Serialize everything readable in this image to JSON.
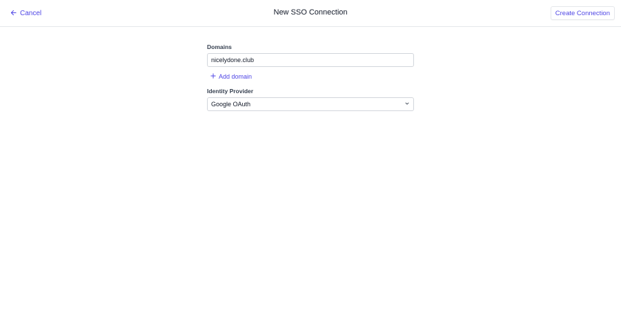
{
  "header": {
    "cancel_label": "Cancel",
    "title": "New SSO Connection",
    "create_label": "Create Connection"
  },
  "form": {
    "domains_label": "Domains",
    "domain_value": "nicelydone.club",
    "add_domain_label": "Add domain",
    "idp_label": "Identity Provider",
    "idp_selected": "Google OAuth"
  },
  "colors": {
    "accent": "#4f46e5",
    "border": "#d1d5db"
  },
  "icons": {
    "cancel": "arrow-left-icon",
    "add": "plus-icon",
    "select": "chevron-down-icon"
  }
}
